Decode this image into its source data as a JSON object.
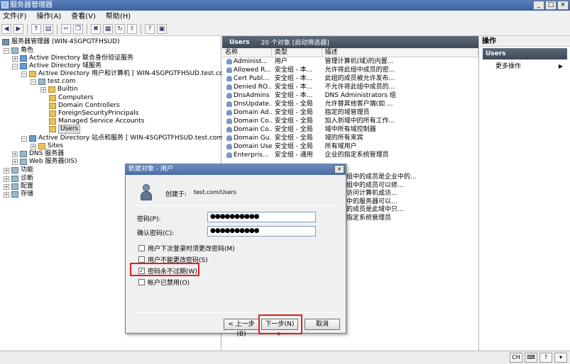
{
  "window": {
    "title": "服务器管理器"
  },
  "menu": [
    "文件(F)",
    "操作(A)",
    "查看(V)",
    "帮助(H)"
  ],
  "tree": {
    "root": "服务器管理器 (WIN-4SGPGTFHSUD)",
    "roles": "角色",
    "adfs": "Active Directory 联合身份验证服务",
    "adds": "Active Directory 域服务",
    "aduc": "Active Directory 用户和计算机 [ WIN-4SGPGTFHSUD.test.com ]",
    "domain": "test.com",
    "builtin": "Builtin",
    "computers": "Computers",
    "dcs": "Domain Controllers",
    "fsp": "ForeignSecurityPrincipals",
    "msa": "Managed Service Accounts",
    "users": "Users",
    "sites_svc": "Active Directory 站点和服务 [ WIN-4SGPGTFHSUD.test.com ]",
    "sites": "Sites",
    "dns": "DNS 服务器",
    "web": "Web 服务器(IIS)",
    "features": "功能",
    "diag": "诊断",
    "config": "配置",
    "storage": "存储"
  },
  "list": {
    "title": "Users",
    "count": "20 个对象 [启动筛选器]",
    "columns": [
      "名称",
      "类型",
      "描述"
    ],
    "rows": [
      {
        "name": "Administ...",
        "type": "用户",
        "desc": "管理计算机(域)的内置..."
      },
      {
        "name": "Allowed R...",
        "type": "安全组 - 本...",
        "desc": "允许将此组中成员的密..."
      },
      {
        "name": "Cert Publ...",
        "type": "安全组 - 本...",
        "desc": "此组的成员被允许发布..."
      },
      {
        "name": "Denied RO...",
        "type": "安全组 - 本...",
        "desc": "不允许将此组中成员的..."
      },
      {
        "name": "DnsAdmins",
        "type": "安全组 - 本...",
        "desc": "DNS Administrators 组"
      },
      {
        "name": "DnsUpdate...",
        "type": "安全组 - 全局",
        "desc": "允许替其他客户端(如 ..."
      },
      {
        "name": "Domain Ad...",
        "type": "安全组 - 全局",
        "desc": "指定的域管理员"
      },
      {
        "name": "Domain Co...",
        "type": "安全组 - 全局",
        "desc": "加入到域中的所有工作..."
      },
      {
        "name": "Domain Co...",
        "type": "安全组 - 全局",
        "desc": "域中所有域控制器"
      },
      {
        "name": "Domain Gu...",
        "type": "安全组 - 全局",
        "desc": "域的所有来宾"
      },
      {
        "name": "Domain Users",
        "type": "安全组 - 全局",
        "desc": "所有域用户"
      },
      {
        "name": "Enterpris...",
        "type": "安全组 - 通用",
        "desc": "企业的指定系统管理员"
      }
    ],
    "partial_descs": [
      "组中的成员是企业中的...",
      "组中的成员可以修...",
      "访问计算机或访...",
      "中的服务器可以...",
      "的成员是此域中只...",
      "指定系统管理员"
    ]
  },
  "actions": {
    "title": "操作",
    "group": "Users",
    "more": "更多操作",
    "more_arrow": "▶"
  },
  "dialog": {
    "title": "新建对象 - 用户",
    "close": "×",
    "created_in_label": "创建于:",
    "created_in_value": "test.com/Users",
    "password_label": "密码(P):",
    "password_value": "●●●●●●●●●●",
    "confirm_label": "确认密码(C):",
    "confirm_value": "●●●●●●●●●●",
    "options": [
      {
        "label": "用户下次登录时须更改密码(M)",
        "checked": false
      },
      {
        "label": "用户不能更改密码(S)",
        "checked": false
      },
      {
        "label": "密码永不过期(W)",
        "checked": true
      },
      {
        "label": "帐户已禁用(O)",
        "checked": false
      }
    ],
    "back": "< 上一步(B)",
    "next": "下一步(N) >",
    "cancel": "取消",
    "check_mark": "✓"
  },
  "status": {
    "lang": "CH"
  },
  "colors": {
    "highlight": "#e02020",
    "titlebar": "#4a6ca5"
  }
}
